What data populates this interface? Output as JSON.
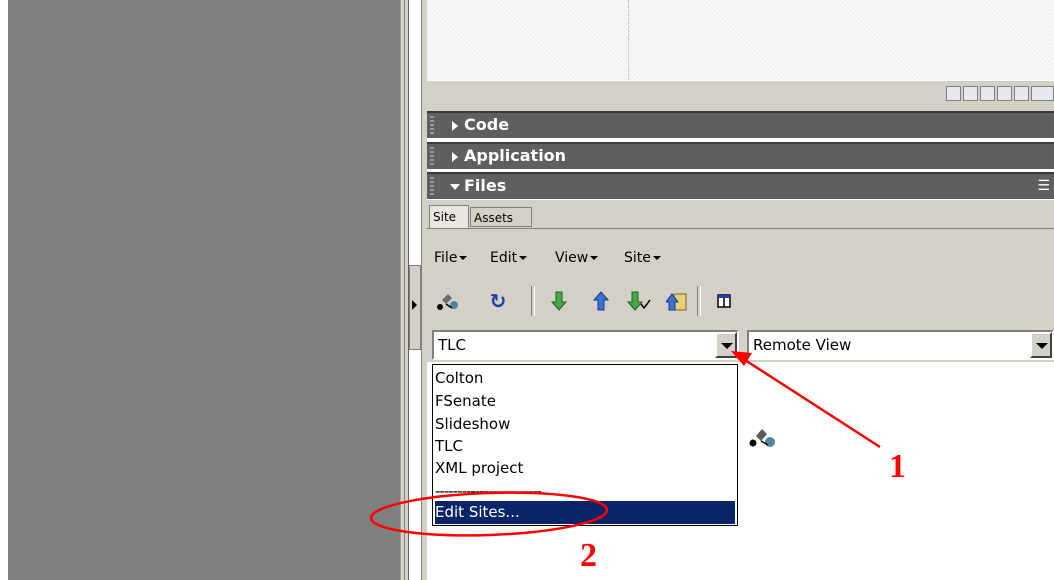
{
  "panels": {
    "code": "Code",
    "application": "Application",
    "files": "Files"
  },
  "tabs": {
    "site": "Site",
    "assets": "Assets"
  },
  "menus": [
    "File",
    "Edit",
    "View",
    "Site"
  ],
  "toolbar_icons": [
    "connect-icon",
    "refresh-icon",
    "get-icon",
    "put-icon",
    "check-in-icon",
    "check-out-icon",
    "expand-icon"
  ],
  "site_select": {
    "value": "TLC"
  },
  "view_select": {
    "value": "Remote View"
  },
  "dropdown": {
    "items": [
      "Colton",
      "FSenate",
      "Slideshow",
      "TLC",
      "XML project"
    ],
    "separator": "------------------------",
    "edit_sites": "Edit Sites..."
  },
  "annotations": {
    "one": "1",
    "two": "2"
  },
  "colors": {
    "annotation": "#ff0000",
    "selection": "#0a246a",
    "panel_header": "#5f5f5f"
  }
}
